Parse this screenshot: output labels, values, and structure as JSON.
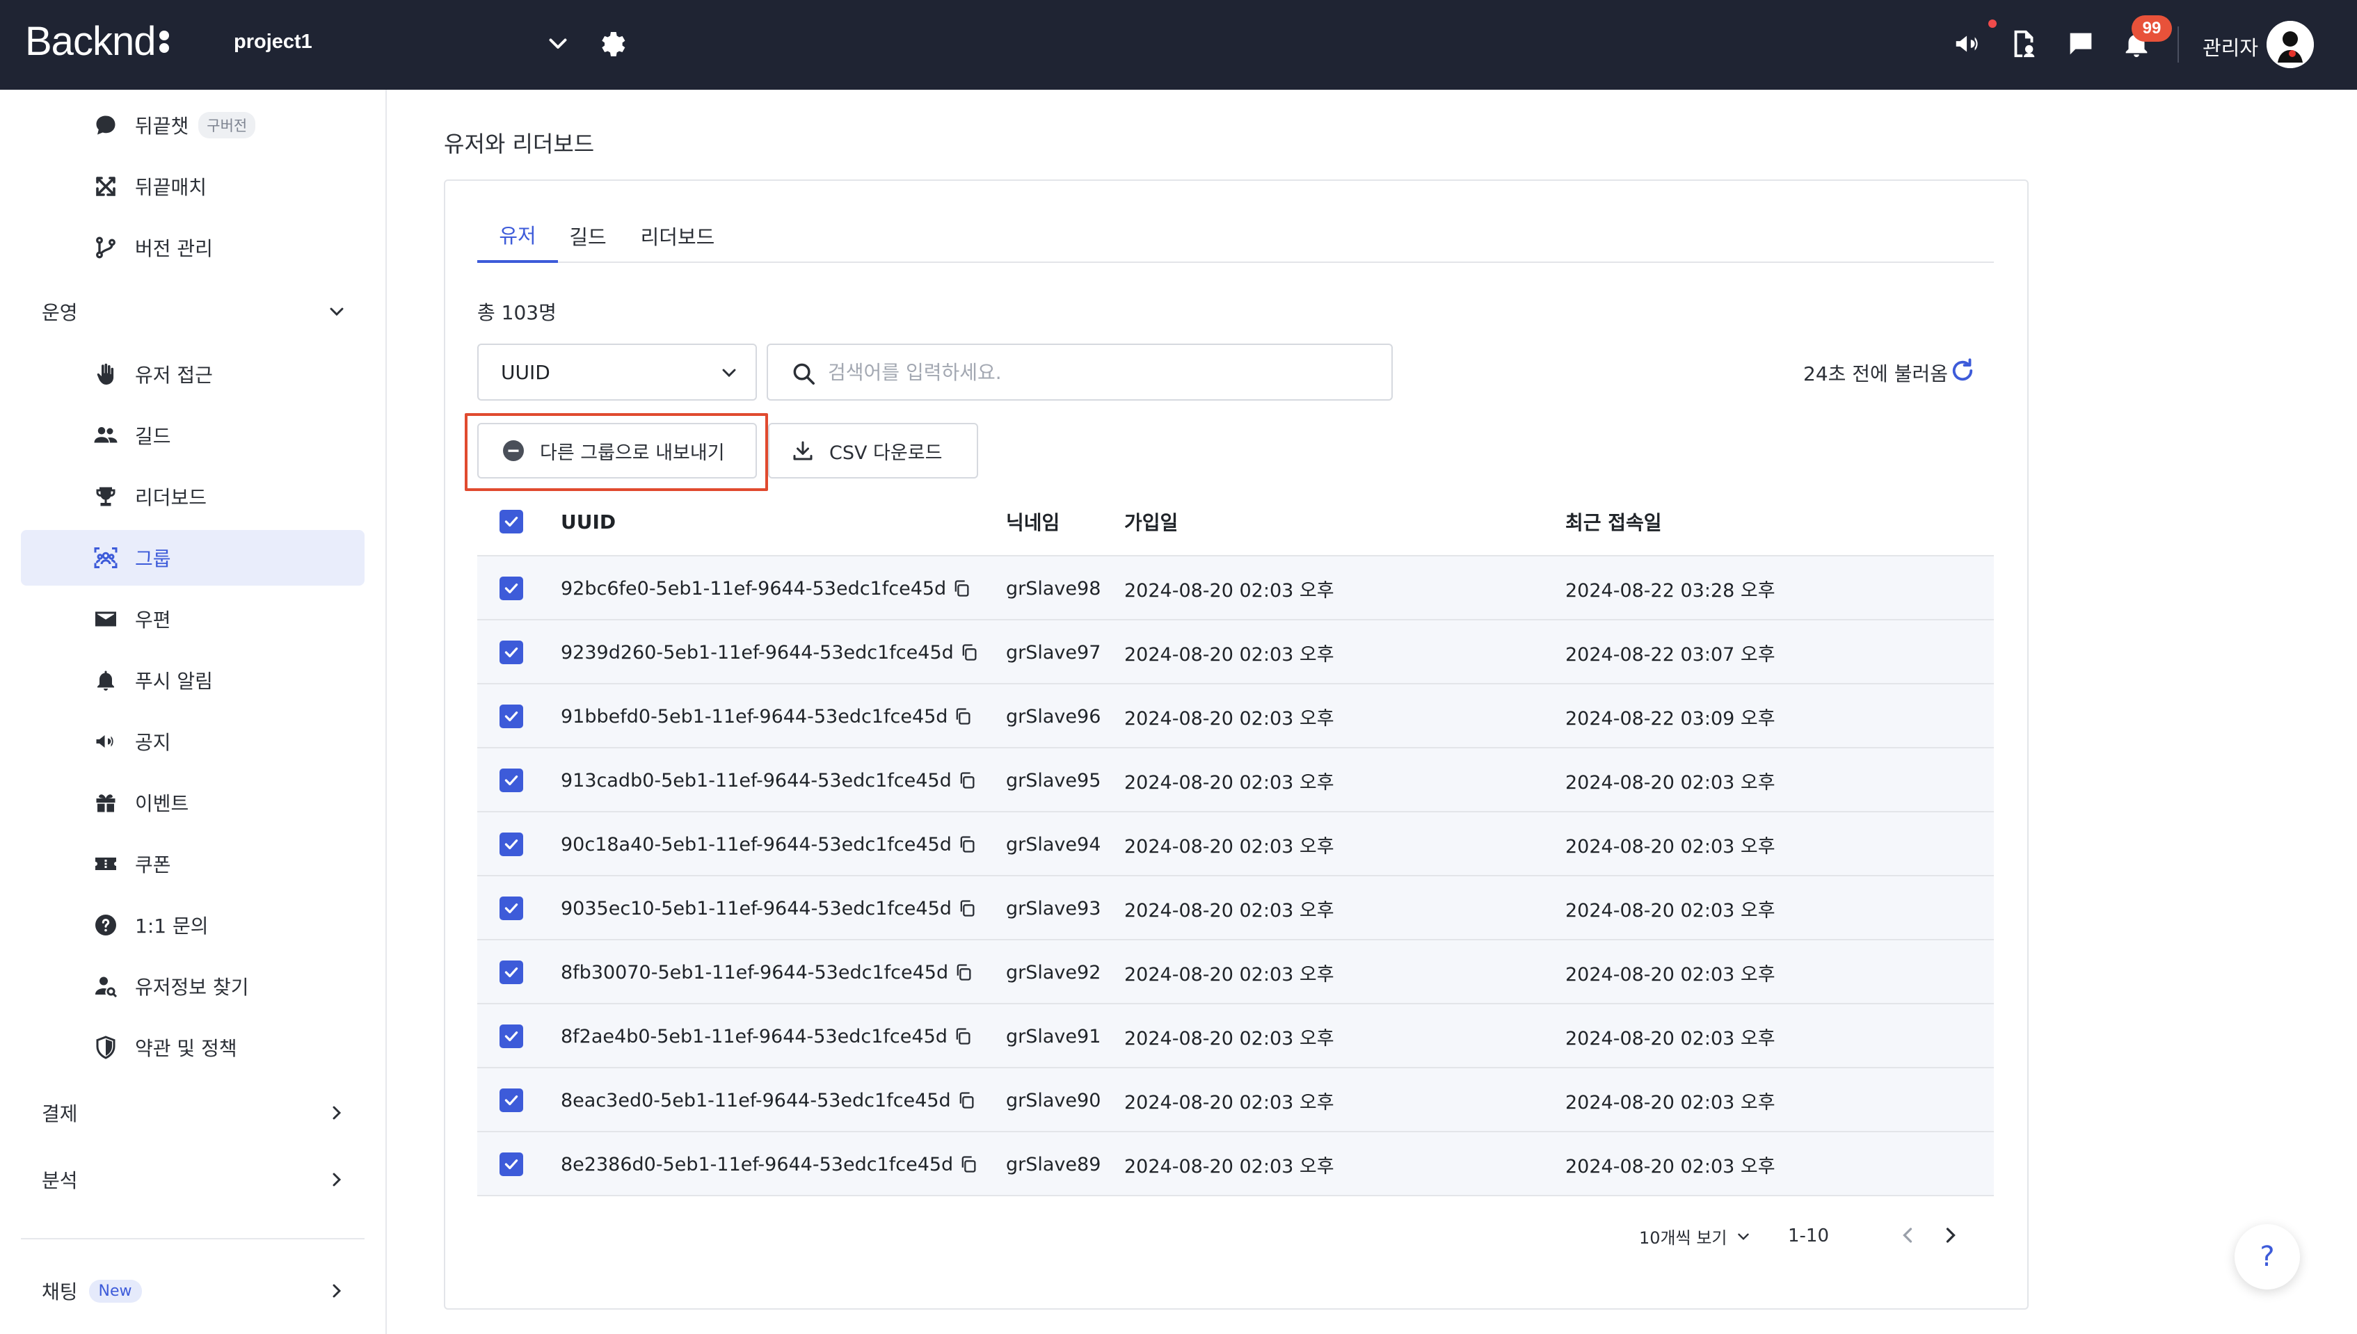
{
  "header": {
    "logo_text": "Backnd",
    "project_name": "project1",
    "notification_count": "99",
    "admin_label": "관리자"
  },
  "sidebar": {
    "items_top": [
      {
        "label": "뒤끝챗",
        "badge": "구버전",
        "icon": "chat-bubble-icon"
      },
      {
        "label": "뒤끝매치",
        "icon": "swords-icon"
      },
      {
        "label": "버전 관리",
        "icon": "branch-icon"
      }
    ],
    "section_operation": "운영",
    "items_operation": [
      {
        "label": "유저 접근",
        "icon": "hand-icon"
      },
      {
        "label": "길드",
        "icon": "users-icon"
      },
      {
        "label": "리더보드",
        "icon": "trophy-icon"
      },
      {
        "label": "그룹",
        "icon": "group-icon",
        "active": true
      },
      {
        "label": "우편",
        "icon": "mail-icon"
      },
      {
        "label": "푸시 알림",
        "icon": "bell-icon"
      },
      {
        "label": "공지",
        "icon": "megaphone-icon"
      },
      {
        "label": "이벤트",
        "icon": "gift-icon"
      },
      {
        "label": "쿠폰",
        "icon": "ticket-icon"
      },
      {
        "label": "1:1 문의",
        "icon": "question-icon"
      },
      {
        "label": "유저정보 찾기",
        "icon": "user-search-icon"
      },
      {
        "label": "약관 및 정책",
        "icon": "shield-icon"
      }
    ],
    "section_payment": "결제",
    "section_analytics": "분석",
    "section_chat": "채팅",
    "chat_badge": "New"
  },
  "main": {
    "page_title": "유저와 리더보드",
    "tabs": [
      "유저",
      "길드",
      "리더보드"
    ],
    "total_label": "총 103명",
    "filter_select": "UUID",
    "search_placeholder": "검색어를 입력하세요.",
    "refresh_text": "24초 전에 불러옴",
    "export_button": "다른 그룹으로 내보내기",
    "csv_button": "CSV 다운로드",
    "columns": [
      "UUID",
      "닉네임",
      "가입일",
      "최근 접속일"
    ],
    "rows": [
      {
        "uuid": "92bc6fe0-5eb1-11ef-9644-53edc1fce45d",
        "nickname": "grSlave98",
        "joined": "2024-08-20 02:03 오후",
        "last": "2024-08-22 03:28 오후"
      },
      {
        "uuid": "9239d260-5eb1-11ef-9644-53edc1fce45d",
        "nickname": "grSlave97",
        "joined": "2024-08-20 02:03 오후",
        "last": "2024-08-22 03:07 오후"
      },
      {
        "uuid": "91bbefd0-5eb1-11ef-9644-53edc1fce45d",
        "nickname": "grSlave96",
        "joined": "2024-08-20 02:03 오후",
        "last": "2024-08-22 03:09 오후"
      },
      {
        "uuid": "913cadb0-5eb1-11ef-9644-53edc1fce45d",
        "nickname": "grSlave95",
        "joined": "2024-08-20 02:03 오후",
        "last": "2024-08-20 02:03 오후"
      },
      {
        "uuid": "90c18a40-5eb1-11ef-9644-53edc1fce45d",
        "nickname": "grSlave94",
        "joined": "2024-08-20 02:03 오후",
        "last": "2024-08-20 02:03 오후"
      },
      {
        "uuid": "9035ec10-5eb1-11ef-9644-53edc1fce45d",
        "nickname": "grSlave93",
        "joined": "2024-08-20 02:03 오후",
        "last": "2024-08-20 02:03 오후"
      },
      {
        "uuid": "8fb30070-5eb1-11ef-9644-53edc1fce45d",
        "nickname": "grSlave92",
        "joined": "2024-08-20 02:03 오후",
        "last": "2024-08-20 02:03 오후"
      },
      {
        "uuid": "8f2ae4b0-5eb1-11ef-9644-53edc1fce45d",
        "nickname": "grSlave91",
        "joined": "2024-08-20 02:03 오후",
        "last": "2024-08-20 02:03 오후"
      },
      {
        "uuid": "8eac3ed0-5eb1-11ef-9644-53edc1fce45d",
        "nickname": "grSlave90",
        "joined": "2024-08-20 02:03 오후",
        "last": "2024-08-20 02:03 오후"
      },
      {
        "uuid": "8e2386d0-5eb1-11ef-9644-53edc1fce45d",
        "nickname": "grSlave89",
        "joined": "2024-08-20 02:03 오후",
        "last": "2024-08-20 02:03 오후"
      }
    ],
    "page_size_label": "10개씩 보기",
    "page_range": "1-10",
    "help_label": "?"
  },
  "colors": {
    "header_bg": "#1f2433",
    "accent": "#3d5bd9",
    "highlight_border": "#e04a2f",
    "badge": "#e8523a"
  }
}
